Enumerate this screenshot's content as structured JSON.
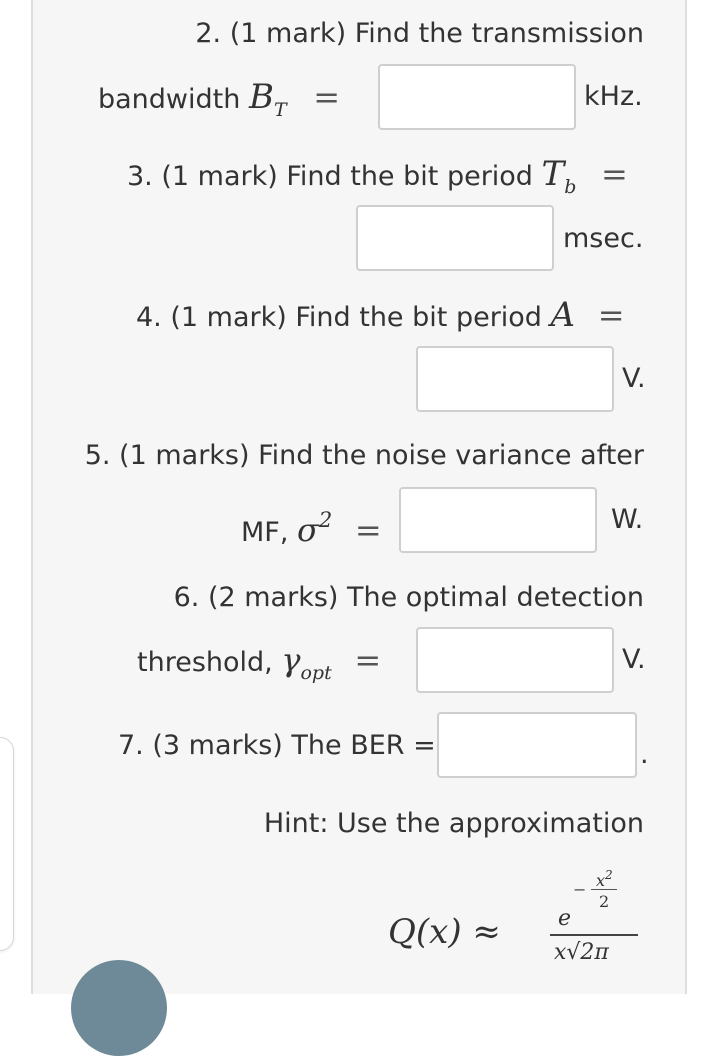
{
  "q2": {
    "text": "2. (1 mark) Find the transmission",
    "lead": "bandwidth",
    "sym": "B",
    "sub": "T",
    "eq": "=",
    "unit": "kHz."
  },
  "q3": {
    "text": "3. (1 mark) Find the bit period",
    "sym": "T",
    "sub": "b",
    "eq": "=",
    "unit": "msec."
  },
  "q4": {
    "text": "4. (1 mark) Find the bit period",
    "sym": "A",
    "eq": "=",
    "unit": "V."
  },
  "q5": {
    "text": "5. (1 marks) Find the noise variance after",
    "lead": "MF,",
    "sym": "σ",
    "sup": "2",
    "eq": "=",
    "unit": "W."
  },
  "q6": {
    "text": "6. (2 marks) The optimal detection",
    "lead": "threshold,",
    "sym": "γ",
    "sub": "opt",
    "eq": "=",
    "unit": "V."
  },
  "q7": {
    "text": "7. (3 marks) The BER =",
    "unit": "."
  },
  "hint": {
    "text": "Hint: Use the approximation",
    "lhs": "Q(x) ≈",
    "num_base": "e",
    "num_exp_minus": "−",
    "num_exp_num": "x",
    "num_exp_num_sup": "2",
    "num_exp_den": "2",
    "den": "x√2π"
  },
  "colors": {
    "panel": "#f6f6f6",
    "box_border": "#cfcfcf",
    "avatar": "#6e8a99"
  }
}
